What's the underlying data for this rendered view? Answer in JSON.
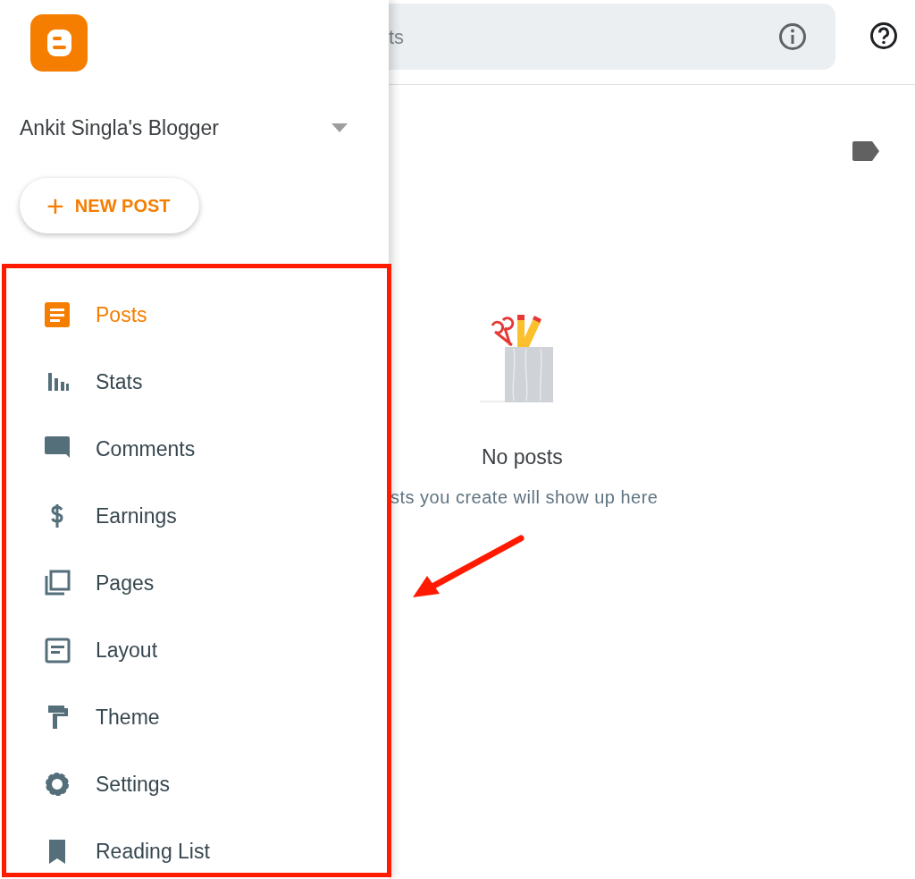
{
  "search": {
    "placeholder": "ts"
  },
  "drawer": {
    "blog_name": "Ankit Singla's Blogger",
    "new_post": {
      "icon": "+",
      "label": "NEW POST"
    },
    "nav_items": [
      {
        "kind": "posts",
        "label": "Posts",
        "selected": true
      },
      {
        "kind": "stats",
        "label": "Stats",
        "selected": false
      },
      {
        "kind": "comments",
        "label": "Comments",
        "selected": false
      },
      {
        "kind": "earnings",
        "label": "Earnings",
        "selected": false
      },
      {
        "kind": "pages",
        "label": "Pages",
        "selected": false
      },
      {
        "kind": "layout",
        "label": "Layout",
        "selected": false
      },
      {
        "kind": "theme",
        "label": "Theme",
        "selected": false
      },
      {
        "kind": "settings",
        "label": "Settings",
        "selected": false
      },
      {
        "kind": "bookmark",
        "label": "Reading List",
        "selected": false
      }
    ]
  },
  "empty_state": {
    "title": "No posts",
    "message": "sts you create will show up here"
  }
}
